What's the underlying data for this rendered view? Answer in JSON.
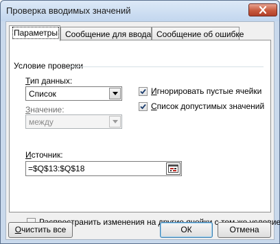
{
  "window": {
    "title": "Проверка вводимых значений"
  },
  "tabs": [
    {
      "label": "Параметры",
      "active": true
    },
    {
      "label": "Сообщение для ввода",
      "active": false
    },
    {
      "label": "Сообщение об ошибке",
      "active": false
    }
  ],
  "section": {
    "title": "Условие проверки"
  },
  "data_type": {
    "label_pre": "",
    "label_key": "Т",
    "label_post": "ип данных:",
    "value": "Список"
  },
  "ignore_blank": {
    "label_pre": "",
    "label_key": "И",
    "label_post": "гнорировать пустые ячейки",
    "checked": true
  },
  "in_cell_dropdown": {
    "label_pre": "",
    "label_key": "С",
    "label_post": "писок допустимых значений",
    "checked": true
  },
  "operator": {
    "label_pre": "",
    "label_key": "З",
    "label_post": "начение:",
    "value": "между"
  },
  "source": {
    "label_pre": "",
    "label_key": "И",
    "label_post": "сточник:",
    "value": "=$Q$13:$Q$18"
  },
  "apply_all": {
    "label_pre": "",
    "label_key": "Р",
    "label_post": "аспространить изменения на другие ячейки с тем же условием",
    "checked": false
  },
  "buttons": {
    "clear_all": {
      "label_pre": "",
      "label_key": "О",
      "label_post": "чистить все"
    },
    "ok": "ОК",
    "cancel": "Отмена"
  }
}
